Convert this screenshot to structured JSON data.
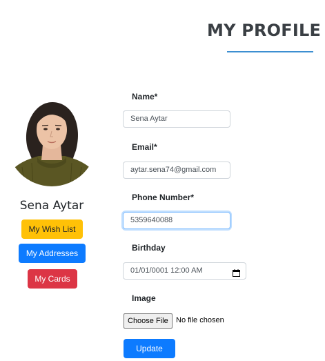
{
  "page": {
    "title": "MY PROFILE"
  },
  "profile": {
    "name": "Sena Aytar",
    "avatar_alt": "profile-photo"
  },
  "sidebar": {
    "buttons": [
      {
        "label": "My Wish List",
        "color": "#ffc107"
      },
      {
        "label": "My Addresses",
        "color": "#0d7bff"
      },
      {
        "label": "My Cards",
        "color": "#dc3545"
      }
    ]
  },
  "form": {
    "name": {
      "label": "Name*",
      "value": "Sena Aytar"
    },
    "email": {
      "label": "Email*",
      "value": "aytar.sena74@gmail.com"
    },
    "phone": {
      "label": "Phone Number*",
      "value": "5359640088"
    },
    "birthday": {
      "label": "Birthday",
      "value": "01/01/0001 12:00 AM"
    },
    "image": {
      "label": "Image",
      "button_label": "Choose File",
      "status": "No file chosen"
    },
    "submit_label": "Update"
  },
  "colors": {
    "accent": "#3d8fd1",
    "primary": "#0d7bff",
    "warning": "#ffc107",
    "danger": "#dc3545"
  },
  "icons": {
    "birthday_picker": "calendar-icon"
  }
}
